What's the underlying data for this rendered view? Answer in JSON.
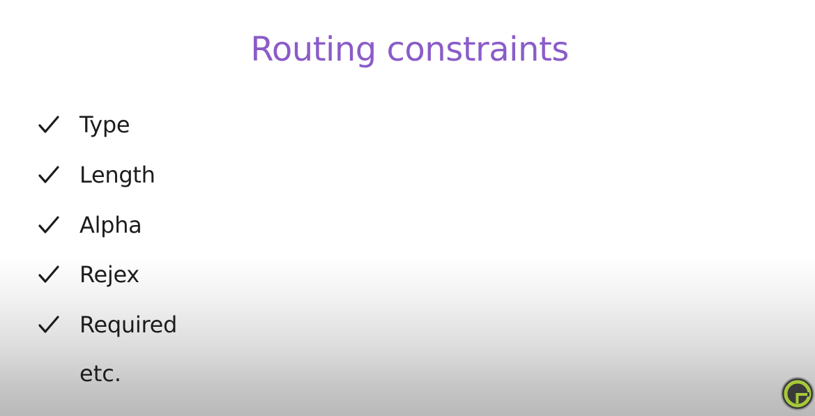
{
  "slide": {
    "title": "Routing constraints",
    "items": [
      {
        "label": "Type"
      },
      {
        "label": "Length"
      },
      {
        "label": "Alpha"
      },
      {
        "label": "Rejex"
      },
      {
        "label": "Required"
      }
    ],
    "footer_text": "etc.",
    "colors": {
      "title": "#8a5cc8",
      "text": "#1c1c1c",
      "logo_ring": "#a6c83a",
      "logo_fill": "#333333"
    },
    "icons": {
      "bullet": "checkmark-icon",
      "corner_logo": "logo-icon"
    }
  }
}
